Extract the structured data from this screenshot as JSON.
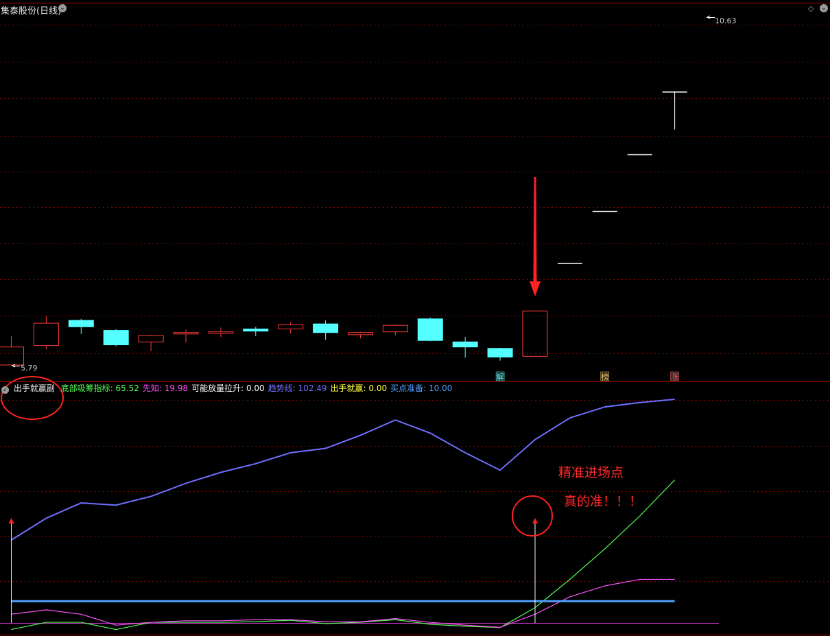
{
  "window": {
    "title": "集泰股份(日线)",
    "colors": {
      "up": "#ff3b3b",
      "down": "#54ffff",
      "grid": "#8b0000",
      "border": "#b00000"
    }
  },
  "price_panel": {
    "high_label": "10.63",
    "low_label": "5.79",
    "markers": [
      {
        "text": "解",
        "color": "#54ffff"
      },
      {
        "text": "榜",
        "color": "#ffcc66"
      },
      {
        "text": "涨",
        "color": "#ff6060"
      }
    ]
  },
  "indicator_panel": {
    "name": "出手就赢副",
    "values": [
      {
        "label": "底部吸筹指标:",
        "value": "65.52",
        "color": "#55ff55"
      },
      {
        "label": "先知:",
        "value": "19.98",
        "color": "#ff55ff"
      },
      {
        "label": "可能放量拉升:",
        "value": "0.00",
        "color": "#ffffff"
      },
      {
        "label": "趋势线:",
        "value": "102.49",
        "color": "#6f6fff"
      },
      {
        "label": "出手就赢:",
        "value": "0.00",
        "color": "#ffff44"
      },
      {
        "label": "买点准备:",
        "value": "10.00",
        "color": "#4f9fff"
      }
    ]
  },
  "annotations": {
    "line1": "精准进场点",
    "line2": "真的准！！！"
  },
  "chart_data": [
    {
      "type": "candlestick",
      "title": "集泰股份(日线)",
      "ylim": [
        5.79,
        10.63
      ],
      "candles": [
        {
          "open": 5.8,
          "close": 6.05,
          "high": 6.2,
          "low": 5.79
        },
        {
          "open": 6.07,
          "close": 6.38,
          "high": 6.48,
          "low": 6.02
        },
        {
          "open": 6.42,
          "close": 6.33,
          "high": 6.44,
          "low": 6.23
        },
        {
          "open": 6.28,
          "close": 6.08,
          "high": 6.3,
          "low": 6.06
        },
        {
          "open": 6.12,
          "close": 6.21,
          "high": 6.22,
          "low": 5.99
        },
        {
          "open": 6.23,
          "close": 6.25,
          "high": 6.29,
          "low": 6.11
        },
        {
          "open": 6.24,
          "close": 6.26,
          "high": 6.32,
          "low": 6.19
        },
        {
          "open": 6.3,
          "close": 6.27,
          "high": 6.33,
          "low": 6.2
        },
        {
          "open": 6.3,
          "close": 6.36,
          "high": 6.4,
          "low": 6.24
        },
        {
          "open": 6.37,
          "close": 6.25,
          "high": 6.42,
          "low": 6.15
        },
        {
          "open": 6.22,
          "close": 6.25,
          "high": 6.26,
          "low": 6.17
        },
        {
          "open": 6.26,
          "close": 6.35,
          "high": 6.36,
          "low": 6.21
        },
        {
          "open": 6.44,
          "close": 6.14,
          "high": 6.46,
          "low": 6.13
        },
        {
          "open": 6.12,
          "close": 6.05,
          "high": 6.19,
          "low": 5.9
        },
        {
          "open": 6.03,
          "close": 5.91,
          "high": 6.04,
          "low": 5.86
        },
        {
          "open": 5.92,
          "close": 6.55,
          "high": 6.55,
          "low": 5.92
        },
        {
          "open": 7.21,
          "close": 7.21,
          "high": 7.21,
          "low": 7.21
        },
        {
          "open": 7.93,
          "close": 7.93,
          "high": 7.93,
          "low": 7.93
        },
        {
          "open": 8.72,
          "close": 8.72,
          "high": 8.72,
          "low": 8.72
        },
        {
          "open": 9.59,
          "close": 9.59,
          "high": 9.59,
          "low": 9.07
        }
      ]
    },
    {
      "type": "line",
      "title": "出手就赢副",
      "x": [
        0,
        1,
        2,
        3,
        4,
        5,
        6,
        7,
        8,
        9,
        10,
        11,
        12,
        13,
        14,
        15,
        16,
        17,
        18,
        19
      ],
      "ylim": [
        0,
        105
      ],
      "series": [
        {
          "name": "趋势线",
          "color": "#6f6fff",
          "values": [
            38,
            48,
            55,
            54,
            58,
            64,
            69,
            73,
            78,
            80,
            86,
            93,
            87,
            78,
            70,
            84,
            94,
            99,
            101,
            102.5
          ]
        },
        {
          "name": "底部吸筹指标",
          "color": "#55ff55",
          "values": [
            -3,
            0.3,
            0.3,
            -3,
            0.3,
            0.3,
            0.3,
            0.6,
            1.2,
            -0.3,
            0.3,
            1.5,
            -0.6,
            -1.5,
            -2.1,
            7,
            20,
            34,
            49,
            65.52
          ]
        },
        {
          "name": "先知",
          "color": "#ff55ff",
          "values": [
            4,
            6,
            4,
            -1,
            0.3,
            1,
            1,
            1.5,
            1.5,
            0.5,
            0.5,
            2,
            0.3,
            -1,
            -2,
            4,
            12,
            17,
            19.98,
            19.98
          ]
        },
        {
          "name": "买点准备",
          "color": "#4f9fff",
          "values": [
            10,
            10,
            10,
            10,
            10,
            10,
            10,
            10,
            10,
            10,
            10,
            10,
            10,
            10,
            10,
            10,
            10,
            10,
            10,
            10
          ]
        }
      ],
      "signals": [
        {
          "name": "出手就赢",
          "x": 0,
          "top": 50,
          "color": "#ffff44"
        },
        {
          "name": "出手就赢",
          "x": 15,
          "top": 50,
          "color": "#ffffff"
        }
      ]
    }
  ]
}
